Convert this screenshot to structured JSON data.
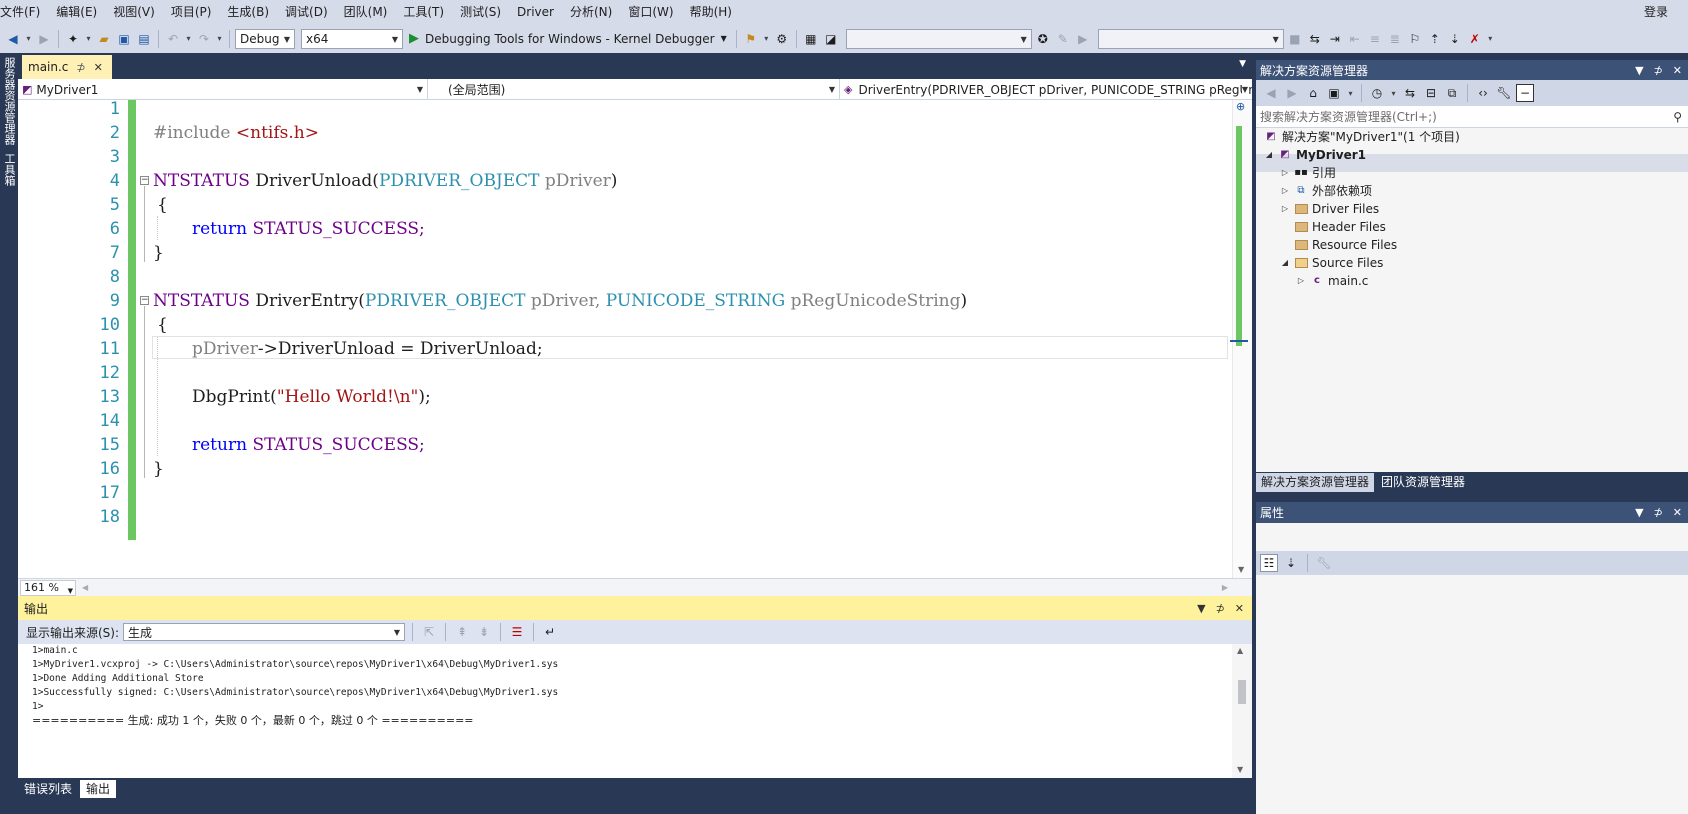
{
  "menu": [
    "文件(F)",
    "编辑(E)",
    "视图(V)",
    "项目(P)",
    "生成(B)",
    "调试(D)",
    "团队(M)",
    "工具(T)",
    "测试(S)",
    "Driver",
    "分析(N)",
    "窗口(W)",
    "帮助(H)"
  ],
  "login": "登录",
  "toolbar": {
    "config": "Debug",
    "platform": "x64",
    "start_label": "Debugging Tools for Windows - Kernel Debugger"
  },
  "left_tabs": [
    "服务器资源管理器",
    "工具箱"
  ],
  "doc_tab": {
    "label": "main.c",
    "pin": "⊅",
    "close": "✕"
  },
  "nav": {
    "project": "MyDriver1",
    "scope": "(全局范围)",
    "member": "DriverEntry(PDRIVER_OBJECT pDriver, PUNICODE_STRING pRegUnicc"
  },
  "code": {
    "line_numbers": [
      "1",
      "2",
      "3",
      "4",
      "5",
      "6",
      "7",
      "8",
      "9",
      "10",
      "11",
      "12",
      "13",
      "14",
      "15",
      "16",
      "17",
      "18"
    ],
    "l2_pp": "#include",
    "l2_inc": "<ntifs.h>",
    "l4_type": "NTSTATUS",
    "l4_name": "DriverUnload",
    "l4_ptype": "PDRIVER_OBJECT",
    "l4_param": "pDriver",
    "l5": "{",
    "l6_kw": "return",
    "l6_val": "STATUS_SUCCESS;",
    "l7": "}",
    "l9_type": "NTSTATUS",
    "l9_name": "DriverEntry",
    "l9_ptype1": "PDRIVER_OBJECT",
    "l9_param1": "pDriver,",
    "l9_ptype2": "PUNICODE_STRING",
    "l9_param2": "pRegUnicodeString",
    "l10": "{",
    "l11_obj": "pDriver",
    "l11_arrow": "->",
    "l11_rest": "DriverUnload = DriverUnload;",
    "l13_fn": "DbgPrint(",
    "l13_str": "\"Hello World!\\n\"",
    "l13_end": ");",
    "l15_kw": "return",
    "l15_val": "STATUS_SUCCESS;",
    "l16": "}"
  },
  "zoom": "161 %",
  "output": {
    "title": "输出",
    "source_label": "显示输出来源(S):",
    "source_value": "生成",
    "lines": [
      "1>main.c",
      "1>MyDriver1.vcxproj -> C:\\Users\\Administrator\\source\\repos\\MyDriver1\\x64\\Debug\\MyDriver1.sys",
      "1>Done Adding Additional Store",
      "1>Successfully signed: C:\\Users\\Administrator\\source\\repos\\MyDriver1\\x64\\Debug\\MyDriver1.sys",
      "1>",
      "========== 生成: 成功 1 个，失败 0 个，最新 0 个，跳过 0 个 =========="
    ]
  },
  "bottom_tabs": [
    "错误列表",
    "输出"
  ],
  "solution_explorer": {
    "title": "解决方案资源管理器",
    "search_placeholder": "搜索解决方案资源管理器(Ctrl+;)",
    "solution": "解决方案\"MyDriver1\"(1 个项目)",
    "project": "MyDriver1",
    "items": [
      "引用",
      "外部依赖项",
      "Driver Files",
      "Header Files",
      "Resource Files",
      "Source Files"
    ],
    "file": "main.c",
    "tabs": [
      "解决方案资源管理器",
      "团队资源管理器"
    ]
  },
  "properties": {
    "title": "属性"
  }
}
